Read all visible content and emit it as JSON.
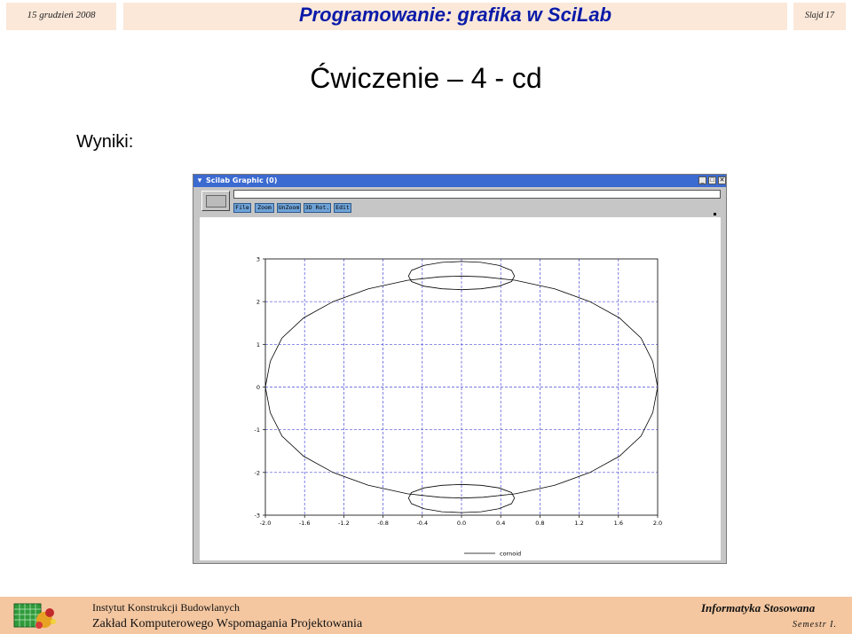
{
  "header": {
    "date": "15 grudzień 2008",
    "title": "Programowanie: grafika w SciLab",
    "slide_number": "Slajd 17"
  },
  "slide": {
    "title": "Ćwiczenie – 4 - cd",
    "results_label": "Wyniki:"
  },
  "scilab_window": {
    "title": "Scilab Graphic (0)",
    "menu": {
      "file": "File",
      "zoom": "Zoom",
      "unzoom": "UnZoom",
      "rot3d": "3D Rot.",
      "edit": "Edit"
    }
  },
  "chart_data": {
    "type": "line",
    "title": "",
    "xlabel": "",
    "ylabel": "",
    "xlim": [
      -2.0,
      2.0
    ],
    "ylim": [
      -3,
      3
    ],
    "xticks": [
      "-2.0",
      "-1.6",
      "-1.2",
      "-0.8",
      "-0.4",
      "0.0",
      "0.4",
      "0.8",
      "1.2",
      "1.6",
      "2.0"
    ],
    "yticks": [
      "-3",
      "-2",
      "-1",
      "0",
      "1",
      "2",
      "3"
    ],
    "grid": true,
    "legend": "bottom-center",
    "series": [
      {
        "name": "cornoid",
        "x": [
          2.0,
          1.95,
          1.83,
          1.61,
          1.31,
          0.95,
          0.55,
          0.22,
          0.0,
          -0.22,
          -0.55,
          -0.95,
          -1.31,
          -1.61,
          -1.83,
          -1.95,
          -2.0,
          -1.95,
          -1.83,
          -1.61,
          -1.31,
          -0.95,
          -0.55,
          -0.22,
          0.0,
          0.22,
          0.55,
          0.95,
          1.31,
          1.61,
          1.83,
          1.95,
          2.0
        ],
        "y": [
          0.0,
          0.6,
          1.15,
          1.62,
          2.0,
          2.3,
          2.5,
          2.58,
          2.6,
          2.58,
          2.5,
          2.3,
          2.0,
          1.62,
          1.15,
          0.6,
          0.0,
          -0.6,
          -1.15,
          -1.62,
          -2.0,
          -2.3,
          -2.5,
          -2.58,
          -2.6,
          -2.58,
          -2.5,
          -2.3,
          -2.0,
          -1.62,
          -1.15,
          -0.6,
          0.0
        ]
      },
      {
        "name": "",
        "x": [
          0.54,
          0.51,
          0.38,
          0.2,
          0.0,
          -0.2,
          -0.38,
          -0.51,
          -0.54,
          -0.51,
          -0.38,
          -0.2,
          0.0,
          0.2,
          0.38,
          0.51,
          0.54
        ],
        "y": [
          2.6,
          2.73,
          2.85,
          2.92,
          2.94,
          2.92,
          2.85,
          2.73,
          2.6,
          2.47,
          2.36,
          2.3,
          2.28,
          2.3,
          2.36,
          2.47,
          2.6
        ]
      },
      {
        "name": "",
        "x": [
          0.54,
          0.51,
          0.38,
          0.2,
          0.0,
          -0.2,
          -0.38,
          -0.51,
          -0.54,
          -0.51,
          -0.38,
          -0.2,
          0.0,
          0.2,
          0.38,
          0.51,
          0.54
        ],
        "y": [
          -2.6,
          -2.47,
          -2.36,
          -2.3,
          -2.28,
          -2.3,
          -2.36,
          -2.47,
          -2.6,
          -2.73,
          -2.85,
          -2.92,
          -2.94,
          -2.92,
          -2.85,
          -2.73,
          -2.6
        ]
      }
    ]
  },
  "footer": {
    "institute": "Instytut Konstrukcji Budowlanych",
    "department": "Zakład Komputerowego Wspomagania Projektowania",
    "course": "Informatyka Stosowana",
    "semester": "Semestr I."
  }
}
